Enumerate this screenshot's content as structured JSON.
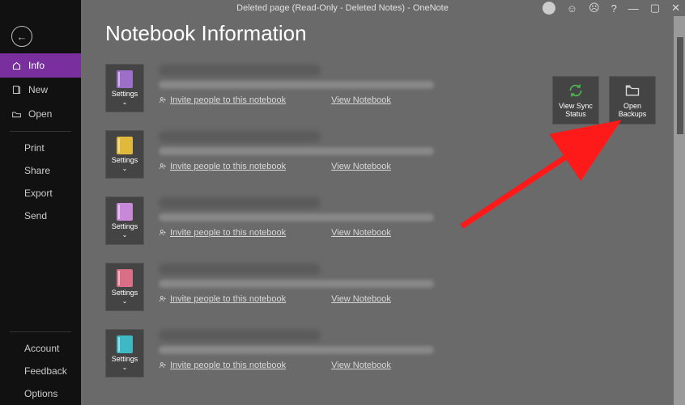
{
  "window": {
    "title": "Deleted page (Read-Only - Deleted Notes)  -  OneNote"
  },
  "sidebar": {
    "items": [
      {
        "label": "Info",
        "icon": "info-icon",
        "active": true
      },
      {
        "label": "New",
        "icon": "new-icon"
      },
      {
        "label": "Open",
        "icon": "open-icon"
      }
    ],
    "sub1": [
      {
        "label": "Print"
      },
      {
        "label": "Share"
      },
      {
        "label": "Export"
      },
      {
        "label": "Send"
      }
    ],
    "bottom": [
      {
        "label": "Account"
      },
      {
        "label": "Feedback"
      },
      {
        "label": "Options"
      }
    ]
  },
  "page": {
    "title": "Notebook Information"
  },
  "tiles": {
    "sync": {
      "line1": "View Sync",
      "line2": "Status"
    },
    "backups": {
      "line1": "Open",
      "line2": "Backups"
    }
  },
  "notebooks": [
    {
      "color": "#9e6fc8",
      "settings": "Settings",
      "invite": "Invite people to this notebook",
      "view": "View Notebook"
    },
    {
      "color": "#e0b83b",
      "settings": "Settings",
      "invite": "Invite people to this notebook",
      "view": "View Notebook"
    },
    {
      "color": "#c888d8",
      "settings": "Settings",
      "invite": "Invite people to this notebook",
      "view": "View Notebook"
    },
    {
      "color": "#d86f86",
      "settings": "Settings",
      "invite": "Invite people to this notebook",
      "view": "View Notebook"
    },
    {
      "color": "#3fb8c6",
      "settings": "Settings",
      "invite": "Invite people to this notebook",
      "view": "View Notebook"
    }
  ]
}
